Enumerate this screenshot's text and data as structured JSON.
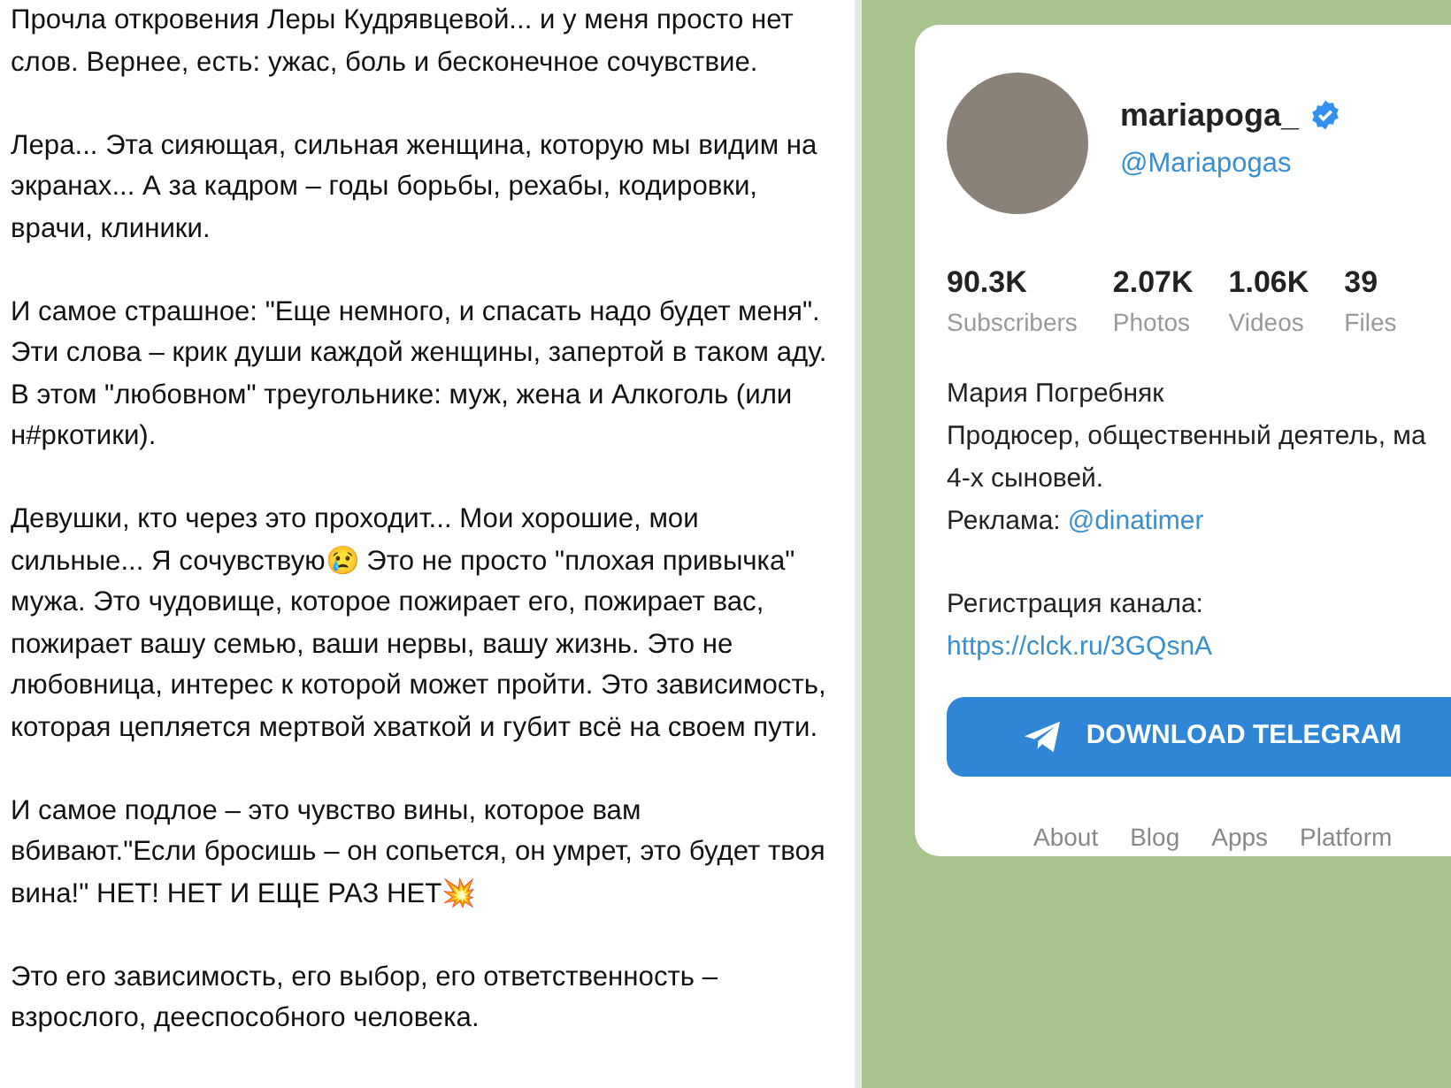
{
  "post": {
    "paragraphs": [
      "Прочла откровения Леры Кудрявцевой... и у меня просто нет слов. Вернее, есть: ужас, боль и бесконечное сочувствие.",
      "Лера... Эта сияющая, сильная женщина, которую мы видим на экранах... А за кадром – годы борьбы, рехабы, кодировки, врачи, клиники.",
      "И самое страшное: \"Еще немного, и спасать надо будет меня\". Эти слова – крик души каждой женщины, запертой в таком аду. В этом \"любовном\" треугольнике: муж, жена и Алкоголь (или н#ркотики).",
      "Девушки, кто через это проходит... Мои хорошие, мои сильные... Я сочувствую😢 Это не просто \"плохая привычка\" мужа. Это чудовище, которое пожирает его, пожирает вас, пожирает вашу семью, ваши нервы, вашу жизнь. Это не любовница, интерес к которой может пройти. Это зависимость, которая цепляется мертвой хваткой и губит всё на своем пути.",
      "И самое подлое – это чувство вины, которое вам вбивают.\"Если бросишь – он сопьется, он умрет, это будет твоя вина!\" НЕТ! НЕТ И ЕЩЕ РАЗ НЕТ💥",
      "Это его зависимость, его выбор, его ответственность – взрослого, дееспособного человека."
    ]
  },
  "channel": {
    "name": "mariapoga_",
    "verified": true,
    "username": "@Mariapogas",
    "stats": [
      {
        "value": "90.3K",
        "label": "Subscribers"
      },
      {
        "value": "2.07K",
        "label": "Photos"
      },
      {
        "value": "1.06K",
        "label": "Videos"
      },
      {
        "value": "39",
        "label": "Files"
      }
    ],
    "bio": {
      "name_line": "Мария Погребняк",
      "role_line": "Продюсер, общественный деятель, ма",
      "role_line_2": "4-х сыновей.",
      "ads_label": "Реклама:",
      "ads_link": "@dinatimer",
      "reg_label": "Регистрация канала:",
      "reg_link": "https://clck.ru/3GQsnA"
    },
    "download_button": "DOWNLOAD TELEGRAM",
    "footer_links": [
      "About",
      "Blog",
      "Apps",
      "Platform"
    ]
  }
}
